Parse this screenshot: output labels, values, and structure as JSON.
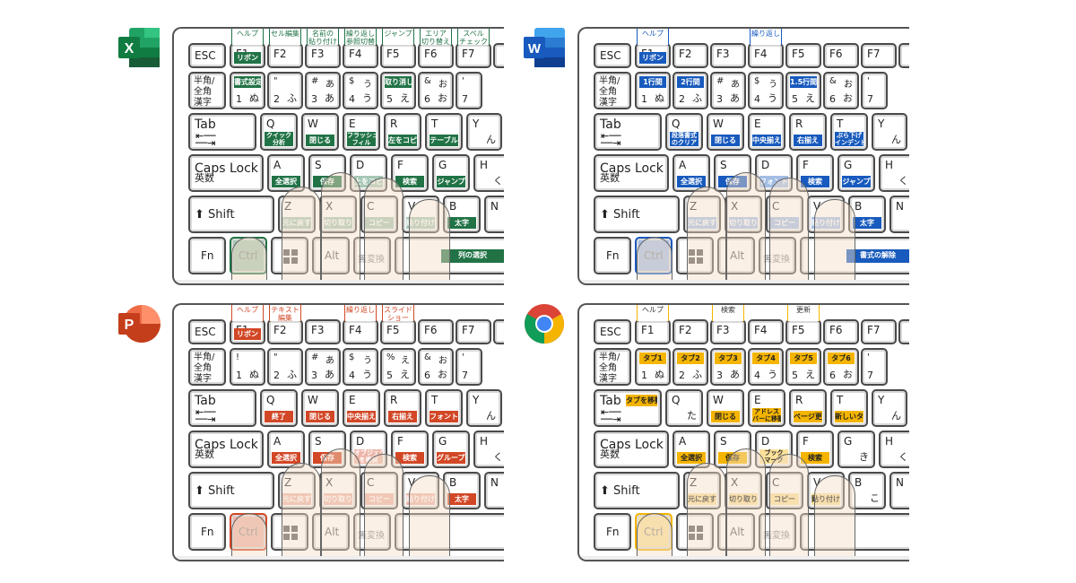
{
  "panels": [
    {
      "app": "Excel",
      "logo_icon": "excel-logo-icon",
      "accent": "#217346",
      "top_labels": {
        "F1": "ヘルプ",
        "F2": "セル編集",
        "F3": "名前の\n貼り付け",
        "F4": "繰り返し\n参照切替",
        "F5": "ジャンプ",
        "F6": "エリア\n切り替え",
        "F7": "スペル\nチェック"
      },
      "f1_sub": "リボン",
      "num_tags": {
        "1": "書式設定",
        "5": "取り消し線"
      },
      "row_q": {
        "Q": "クイック\n分析",
        "W": "閉じる",
        "E": "フラッシュ\nフィル",
        "R": "左をコピペ",
        "T": "テーブル"
      },
      "row_a": {
        "A": "全選択",
        "S": "保存",
        "D": "上をコピペ",
        "F": "検索",
        "G": "ジャンプ"
      },
      "row_z": {
        "Z": "元に戻す",
        "X": "切り取り",
        "C": "コピー",
        "V": "貼り付け",
        "B": "太字"
      },
      "space_tag": "列の選択",
      "tab_tag": "",
      "q_kana": "",
      "g_kana": "",
      "b_kana": ""
    },
    {
      "app": "Word",
      "logo_icon": "word-logo-icon",
      "accent": "#185abd",
      "top_labels": {
        "F1": "ヘルプ",
        "F4": "繰り返し"
      },
      "f1_sub": "リボン",
      "num_tags": {
        "1": "1行間",
        "2": "2行間",
        "5": "1.5行間"
      },
      "row_q": {
        "Q": "段落書式\nのクリア",
        "W": "閉じる",
        "E": "中央揃え",
        "R": "右揃え",
        "T": "ぶら下げ\nインデント"
      },
      "row_a": {
        "A": "全選択",
        "S": "保存",
        "D": "フォント",
        "F": "検索",
        "G": "ジャンプ"
      },
      "row_z": {
        "Z": "元に戻す",
        "X": "切り取り",
        "C": "コピー",
        "V": "貼り付け",
        "B": "太字"
      },
      "space_tag": "書式の解除",
      "tab_tag": "",
      "q_kana": "",
      "g_kana": "",
      "b_kana": ""
    },
    {
      "app": "PowerPoint",
      "logo_icon": "powerpoint-logo-icon",
      "accent": "#d24726",
      "top_labels": {
        "F1": "ヘルプ",
        "F2": "テキスト\n編集",
        "F4": "繰り返し",
        "F5": "スライド\nショー"
      },
      "f1_sub": "リボン",
      "num_tags": {},
      "row_q": {
        "Q": "終了",
        "W": "閉じる",
        "E": "中央揃え",
        "R": "右揃え",
        "T": "フォント"
      },
      "row_a": {
        "A": "全選択",
        "S": "保存",
        "D": "オブジェクト\nを複製",
        "F": "検索",
        "G": "グループ化"
      },
      "row_z": {
        "Z": "元に戻す",
        "X": "切り取り",
        "C": "コピー",
        "V": "貼り付け",
        "B": "太字"
      },
      "space_tag": "",
      "tab_tag": "",
      "q_kana": "",
      "g_kana": "",
      "b_kana": ""
    },
    {
      "app": "Chrome",
      "logo_icon": "chrome-logo-icon",
      "accent": "#f4b400",
      "top_labels": {
        "F1": "ヘルプ",
        "F3": "検索",
        "F5": "更新"
      },
      "f1_sub": "",
      "num_tags": {
        "1": "タブ1",
        "2": "タブ2",
        "3": "タブ3",
        "4": "タブ4",
        "5": "タブ5",
        "6": "タブ6"
      },
      "row_q": {
        "W": "閉じる",
        "E": "アドレス\nバーに移動",
        "R": "ページ更新",
        "T": "新しいタブ"
      },
      "row_a": {
        "A": "全選択",
        "S": "保存",
        "D": "ブック\nマーク",
        "F": "検索"
      },
      "row_z": {
        "Z": "元に戻す",
        "X": "切り取り",
        "C": "コピー",
        "V": "貼り付け"
      },
      "space_tag": "",
      "tab_tag": "タブを移動",
      "q_kana": "た",
      "g_kana": "き",
      "b_kana": "こ"
    }
  ],
  "keys": {
    "esc": "ESC",
    "fkeys": [
      "F1",
      "F2",
      "F3",
      "F4",
      "F5",
      "F6",
      "F7"
    ],
    "hankaku": "半角/\n全角\n漢字",
    "nums": [
      {
        "n": "1",
        "sym": "!",
        "kana": "ぬ",
        "skana": ""
      },
      {
        "n": "2",
        "sym": "\"",
        "kana": "ふ",
        "skana": ""
      },
      {
        "n": "3",
        "sym": "#",
        "kana": "あ",
        "skana": "あ"
      },
      {
        "n": "4",
        "sym": "$",
        "kana": "う",
        "skana": "う"
      },
      {
        "n": "5",
        "sym": "%",
        "kana": "え",
        "skana": "え"
      },
      {
        "n": "6",
        "sym": "&",
        "kana": "お",
        "skana": "お"
      },
      {
        "n": "7",
        "sym": "'",
        "kana": "",
        "skana": ""
      }
    ],
    "tab": "Tab",
    "caps": "Caps Lock",
    "caps_sub": "英数",
    "shift": "Shift",
    "fn": "Fn",
    "ctrl": "Ctrl",
    "alt": "Alt",
    "muhenkan": "無変換",
    "row_q": [
      "Q",
      "W",
      "E",
      "R",
      "T",
      "Y"
    ],
    "row_a": [
      "A",
      "S",
      "D",
      "F",
      "G",
      "H"
    ],
    "row_z": [
      "Z",
      "X",
      "C",
      "V",
      "B",
      "N"
    ],
    "y_kana": "ん",
    "h_kana": "く"
  }
}
